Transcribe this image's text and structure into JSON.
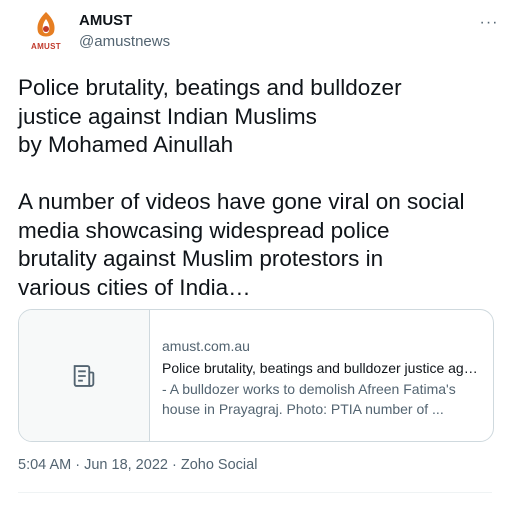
{
  "author": {
    "name": "AMUST",
    "handle": "@amustnews",
    "logo_text": "AMUST",
    "logo_colors": {
      "primary": "#e67e22",
      "accent": "#c0392b"
    }
  },
  "header": {
    "more_icon": "more-icon",
    "more_label": "···"
  },
  "tweet": {
    "text_lines": [
      "Police brutality, beatings and bulldozer",
      "justice against Indian Muslims",
      "by Mohamed Ainullah",
      "",
      "A number of videos have gone viral on social",
      "media showcasing widespread police",
      "brutality against Muslim protestors in",
      "various cities of India…"
    ]
  },
  "card": {
    "icon": "article-icon",
    "domain": "amust.com.au",
    "title": "Police brutality, beatings and bulldozer justice against Indian Muslims",
    "desc_lines": [
      "- A bulldozer works to demolish Afreen Fatima's",
      "house in Prayagraj. Photo: PTIA number of ..."
    ]
  },
  "meta": {
    "time": "5:04 AM",
    "separator": " · ",
    "date": "Jun 18, 2022",
    "source": "Zoho Social"
  }
}
